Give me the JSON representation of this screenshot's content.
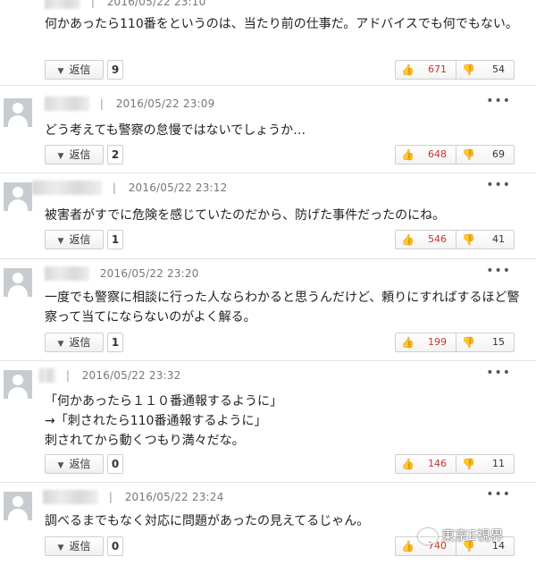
{
  "comments": [
    {
      "timestamp": "2016/05/22 23:10",
      "text": "何かあったら110番をというのは、当たり前の仕事だ。アドバイスでも何でもない。",
      "reply_label": "返信",
      "reply_count": "9",
      "likes": "671",
      "dislikes": "54"
    },
    {
      "timestamp": "2016/05/22 23:09",
      "text": "どう考えても警察の怠慢ではないでしょうか…",
      "reply_label": "返信",
      "reply_count": "2",
      "likes": "648",
      "dislikes": "69"
    },
    {
      "timestamp": "2016/05/22 23:12",
      "text": "被害者がすでに危険を感じていたのだから、防げた事件だったのにね。",
      "reply_label": "返信",
      "reply_count": "1",
      "likes": "546",
      "dislikes": "41"
    },
    {
      "timestamp": "2016/05/22 23:20",
      "text": "一度でも警察に相談に行った人ならわかると思うんだけど、頼りにすればするほど警察って当てにならないのがよく解る。",
      "reply_label": "返信",
      "reply_count": "1",
      "likes": "199",
      "dislikes": "15"
    },
    {
      "timestamp": "2016/05/22 23:32",
      "text_lines": [
        "「何かあったら１１０番通報するように」",
        "→「刺されたら110番通報するように」",
        "刺されてから動くつもり満々だな。"
      ],
      "reply_label": "返信",
      "reply_count": "0",
      "likes": "146",
      "dislikes": "11"
    },
    {
      "timestamp": "2016/05/22 23:24",
      "text": "調べるまでもなく対応に問題があったの見えてるじゃん。",
      "reply_label": "返信",
      "reply_count": "0",
      "likes": "740",
      "dislikes": "14"
    }
  ],
  "separator": "|",
  "menu_dots": "•••",
  "icons": {
    "menu": "more-dots-icon",
    "like": "thumbs-up-icon",
    "dislike": "thumbs-down-icon",
    "avatar": "default-user-avatar-icon",
    "reply": "chevron-down-icon"
  },
  "colors": {
    "like_count": "#c0392b",
    "avatar_bg": "#c8ccd0"
  },
  "watermark": "東京E視界"
}
